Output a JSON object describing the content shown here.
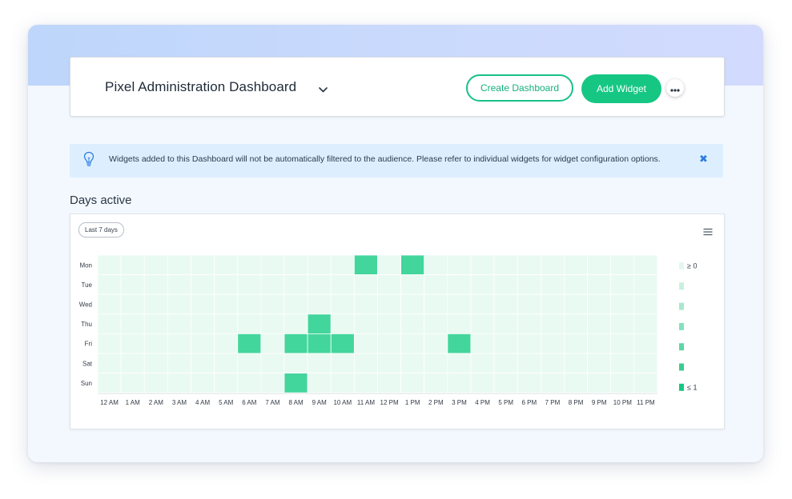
{
  "header": {
    "title": "Pixel Administration Dashboard",
    "create_label": "Create Dashboard",
    "add_label": "Add Widget"
  },
  "notice": {
    "text": "Widgets added to this Dashboard will not be automatically filtered to the audience. Please refer to individual widgets for widget configuration options.",
    "close_glyph": "✖"
  },
  "section": {
    "title": "Days active"
  },
  "widget": {
    "period_label": "Last 7 days"
  },
  "colors": {
    "accent": "#16c784",
    "cell_empty": "#e9faf2",
    "cell_active": "#43d69c",
    "notice_bg": "#ddefff",
    "close": "#2e7de0"
  },
  "icons": {
    "title_dropdown": "chevron-down-icon",
    "more": "ellipsis-icon",
    "notice": "lightbulb-icon",
    "chart_menu": "hamburger-menu-icon"
  },
  "chart_data": {
    "type": "heatmap",
    "x_labels": [
      "12 AM",
      "1 AM",
      "2 AM",
      "3 AM",
      "4 AM",
      "5 AM",
      "6 AM",
      "7 AM",
      "8 AM",
      "9 AM",
      "10 AM",
      "11 AM",
      "12 PM",
      "1 PM",
      "2 PM",
      "3 PM",
      "4 PM",
      "5 PM",
      "6 PM",
      "7 PM",
      "8 PM",
      "9 PM",
      "10 PM",
      "11 PM"
    ],
    "y_labels": [
      "Mon",
      "Tue",
      "Wed",
      "Thu",
      "Fri",
      "Sat",
      "Sun"
    ],
    "values": [
      [
        0,
        0,
        0,
        0,
        0,
        0,
        0,
        0,
        0,
        0,
        0,
        1,
        0,
        1,
        0,
        0,
        0,
        0,
        0,
        0,
        0,
        0,
        0,
        0
      ],
      [
        0,
        0,
        0,
        0,
        0,
        0,
        0,
        0,
        0,
        0,
        0,
        0,
        0,
        0,
        0,
        0,
        0,
        0,
        0,
        0,
        0,
        0,
        0,
        0
      ],
      [
        0,
        0,
        0,
        0,
        0,
        0,
        0,
        0,
        0,
        0,
        0,
        0,
        0,
        0,
        0,
        0,
        0,
        0,
        0,
        0,
        0,
        0,
        0,
        0
      ],
      [
        0,
        0,
        0,
        0,
        0,
        0,
        0,
        0,
        0,
        1,
        0,
        0,
        0,
        0,
        0,
        0,
        0,
        0,
        0,
        0,
        0,
        0,
        0,
        0
      ],
      [
        0,
        0,
        0,
        0,
        0,
        0,
        1,
        0,
        1,
        1,
        1,
        0,
        0,
        0,
        0,
        1,
        0,
        0,
        0,
        0,
        0,
        0,
        0,
        0
      ],
      [
        0,
        0,
        0,
        0,
        0,
        0,
        0,
        0,
        0,
        0,
        0,
        0,
        0,
        0,
        0,
        0,
        0,
        0,
        0,
        0,
        0,
        0,
        0,
        0
      ],
      [
        0,
        0,
        0,
        0,
        0,
        0,
        0,
        0,
        1,
        0,
        0,
        0,
        0,
        0,
        0,
        0,
        0,
        0,
        0,
        0,
        0,
        0,
        0,
        0
      ]
    ],
    "legend": {
      "min_label": "≥ 0",
      "max_label": "≤ 1",
      "swatches": [
        "#e3f7ee",
        "#c9f0df",
        "#a8e8ce",
        "#86e0bc",
        "#5fd6a6",
        "#3ccc92",
        "#16c784"
      ]
    }
  }
}
